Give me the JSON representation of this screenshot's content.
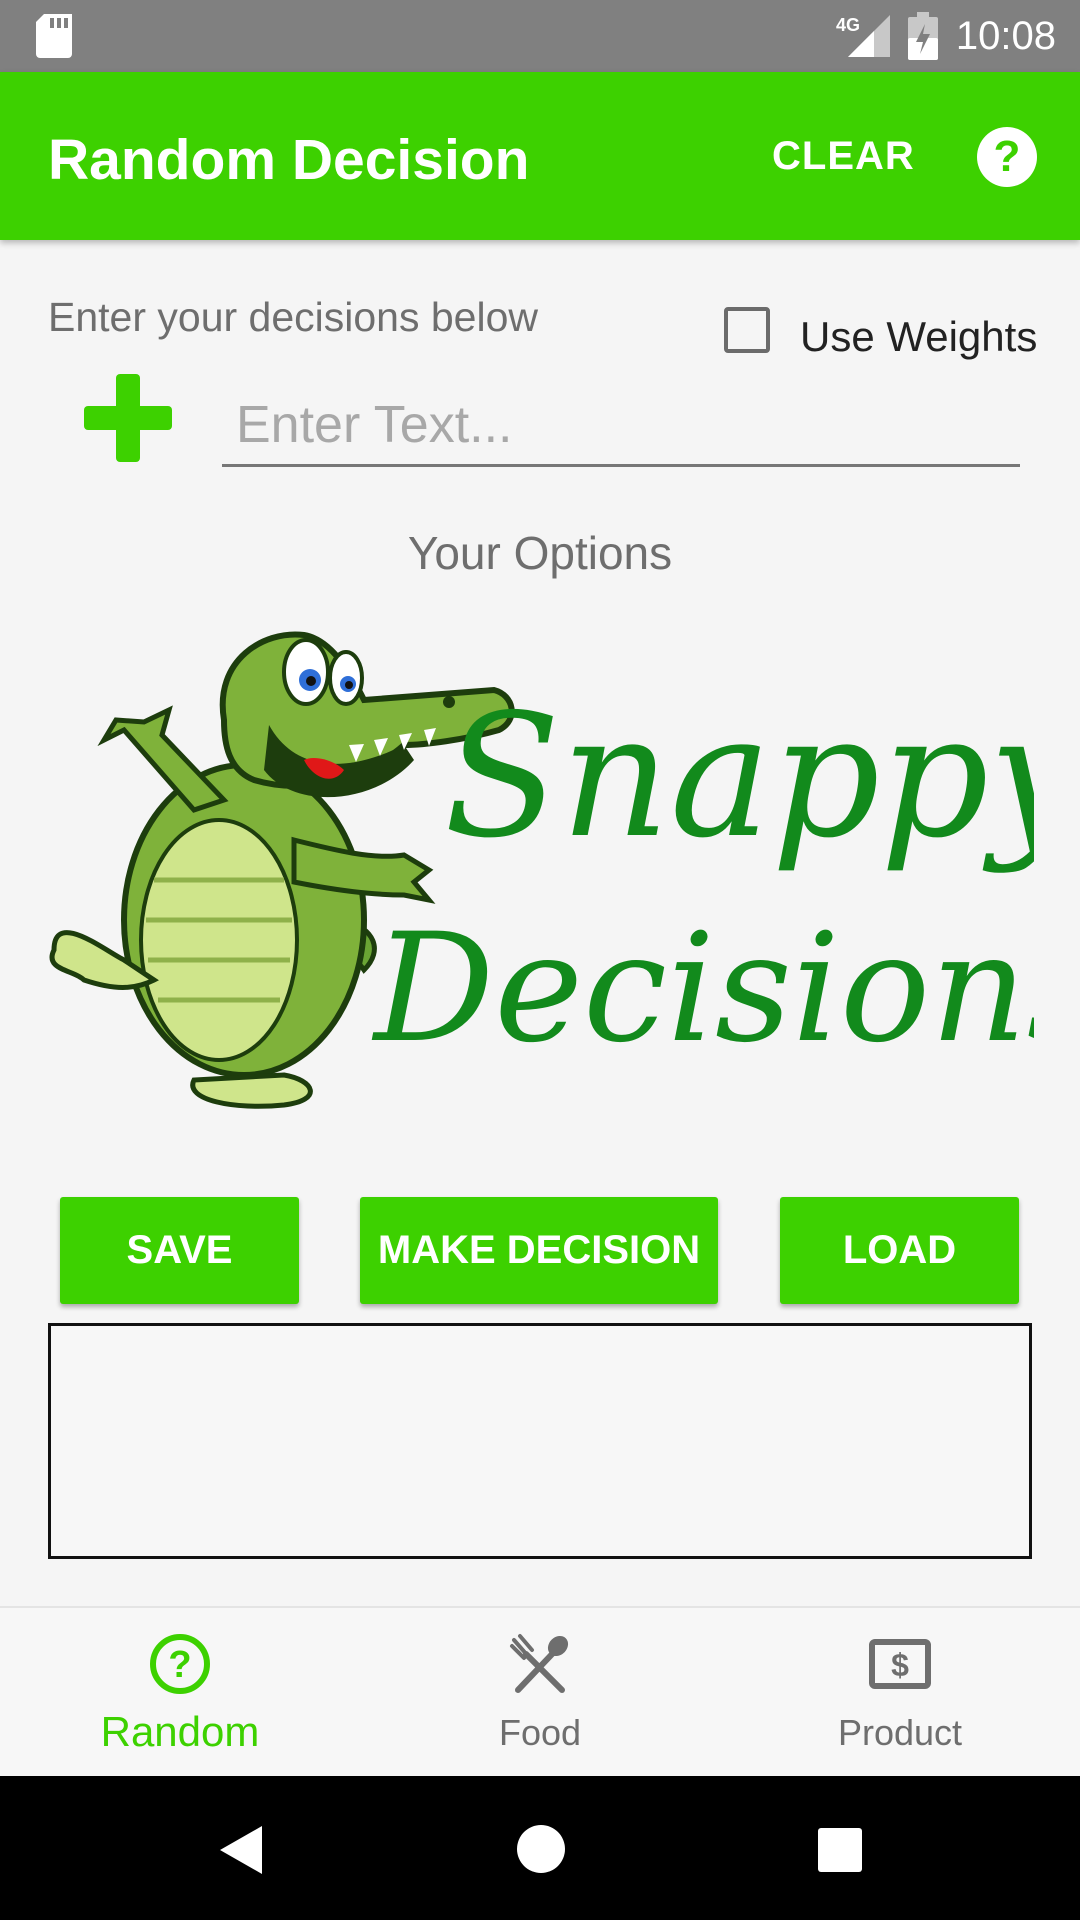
{
  "status_bar": {
    "time": "10:08",
    "network": "4G",
    "icons": [
      "sd-card-icon",
      "signal-icon",
      "battery-icon"
    ]
  },
  "app_bar": {
    "title": "Random Decision",
    "clear_label": "CLEAR",
    "help_icon": "help-icon",
    "color": "#3dd100"
  },
  "form": {
    "instruction": "Enter your decisions below",
    "use_weights_label": "Use Weights",
    "use_weights_checked": false,
    "input_placeholder": "Enter Text...",
    "input_value": ""
  },
  "options": {
    "title": "Your Options"
  },
  "logo": {
    "line1": "Snappy",
    "line2": "Decisions"
  },
  "actions": {
    "save_label": "SAVE",
    "decide_label": "MAKE DECISION",
    "load_label": "LOAD"
  },
  "bottom_nav": {
    "items": [
      {
        "label": "Random",
        "icon": "help-circle-icon",
        "active": true
      },
      {
        "label": "Food",
        "icon": "fork-spoon-icon",
        "active": false
      },
      {
        "label": "Product",
        "icon": "dollar-tag-icon",
        "active": false
      }
    ],
    "active_color": "#3dd100",
    "inactive_color": "#6e6e6e"
  },
  "system_nav": {
    "icons": [
      "back-icon",
      "home-icon",
      "recents-icon"
    ]
  }
}
